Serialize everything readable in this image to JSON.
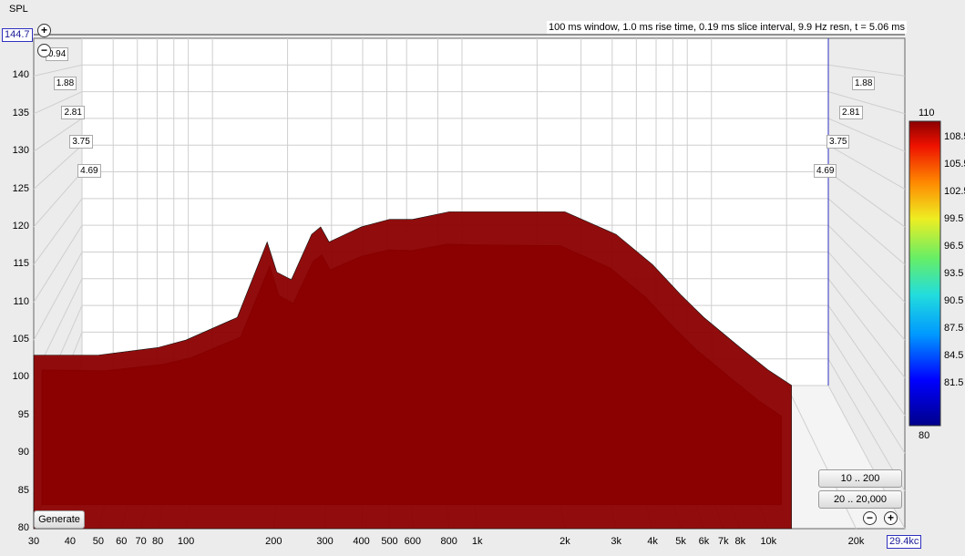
{
  "header": {
    "spl_label": "SPL",
    "top_readout": "144.7",
    "right_readout": "29.4kc",
    "info": "100 ms window, 1.0 ms rise time, 0.19 ms slice interval, 9.9 Hz resn, t = 5.06 ms"
  },
  "buttons": {
    "generate": "Generate",
    "range_a": "10 .. 200",
    "range_b": "20 .. 20,000",
    "zoom_in": "+",
    "zoom_out": "−"
  },
  "colors": {
    "background": "#ececec",
    "grid": "#c8c8c8",
    "cursor_line": "#3030c0"
  },
  "chart_data": {
    "type": "heatmap",
    "subtype": "cumulative spectral decay (waterfall)",
    "ylabel": "SPL",
    "ylim": [
      80,
      145
    ],
    "y_ticks": [
      "80",
      "85",
      "90",
      "95",
      "100",
      "105",
      "110",
      "115",
      "120",
      "125",
      "130",
      "135",
      "140"
    ],
    "x_scale": "log",
    "xlim": [
      30,
      29400
    ],
    "x_ticks": [
      "30",
      "40",
      "50",
      "60",
      "70",
      "80",
      "100",
      "200",
      "300",
      "400",
      "500",
      "600",
      "800",
      "1k",
      "2k",
      "3k",
      "4k",
      "5k",
      "6k",
      "7k",
      "8k",
      "10k",
      "20k"
    ],
    "time_ticks_ms": [
      "0.94",
      "1.88",
      "2.81",
      "3.75",
      "4.69"
    ],
    "colorbar": {
      "min": 80,
      "max": 110,
      "max_label": "110",
      "min_label": "80",
      "ticks": [
        "108.5",
        "105.5",
        "102.5",
        "99.5",
        "96.5",
        "93.5",
        "90.5",
        "87.5",
        "84.5",
        "81.5"
      ]
    },
    "slices_ms": [
      0.0,
      0.94,
      1.88,
      2.81,
      3.75,
      4.69
    ],
    "front_slice": {
      "freq_hz": [
        30,
        50,
        80,
        100,
        150,
        190,
        205,
        230,
        270,
        290,
        310,
        400,
        500,
        600,
        800,
        1000,
        2000,
        3000,
        4000,
        5000,
        6000,
        8000,
        10000,
        12000
      ],
      "spl_db": [
        103,
        103,
        104,
        105,
        108,
        118,
        114,
        113,
        119,
        120,
        118,
        120,
        121,
        121,
        122,
        122,
        122,
        119,
        115,
        111,
        108,
        104,
        101,
        99
      ]
    }
  }
}
